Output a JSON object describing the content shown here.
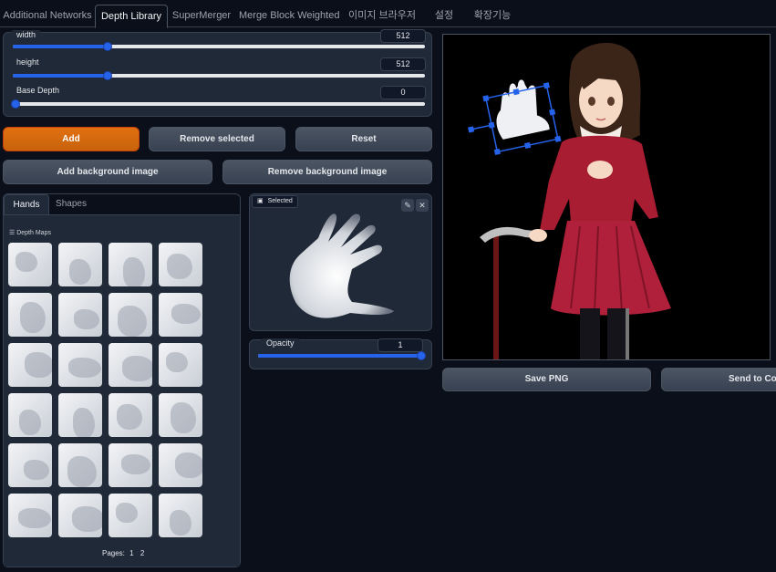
{
  "tabs": [
    {
      "label": "Additional Networks",
      "active": false
    },
    {
      "label": "Depth Library",
      "active": true
    },
    {
      "label": "SuperMerger",
      "active": false
    },
    {
      "label": "Merge Block Weighted",
      "active": false
    },
    {
      "label": "이미지 브라우저",
      "active": false
    },
    {
      "label": "설정",
      "active": false
    },
    {
      "label": "확장기능",
      "active": false
    }
  ],
  "sliders": {
    "width": {
      "label": "width",
      "value": "512",
      "fraction": 0.23
    },
    "height": {
      "label": "height",
      "value": "512",
      "fraction": 0.23
    },
    "base_depth": {
      "label": "Base Depth",
      "value": "0",
      "fraction": 0.0
    }
  },
  "buttons": {
    "add": "Add",
    "remove_selected": "Remove selected",
    "reset": "Reset",
    "add_background": "Add background image",
    "remove_background": "Remove background image",
    "save_png": "Save PNG",
    "send_to": "Send to Con"
  },
  "library": {
    "tabs": [
      "Hands",
      "Shapes"
    ],
    "section_title": "☰ Depth Maps",
    "pages_label": "Pages:",
    "pages": [
      "1",
      "2"
    ]
  },
  "selected": {
    "label": "Selected",
    "opacity_label": "Opacity",
    "opacity_value": "1",
    "opacity_fraction": 1.0
  },
  "icons": {
    "image": "image-icon",
    "edit": "pencil-icon",
    "close": "close-icon"
  },
  "colors": {
    "accent": "#2563eb",
    "primary_button": "#d97706",
    "background": "#0b0f19"
  }
}
